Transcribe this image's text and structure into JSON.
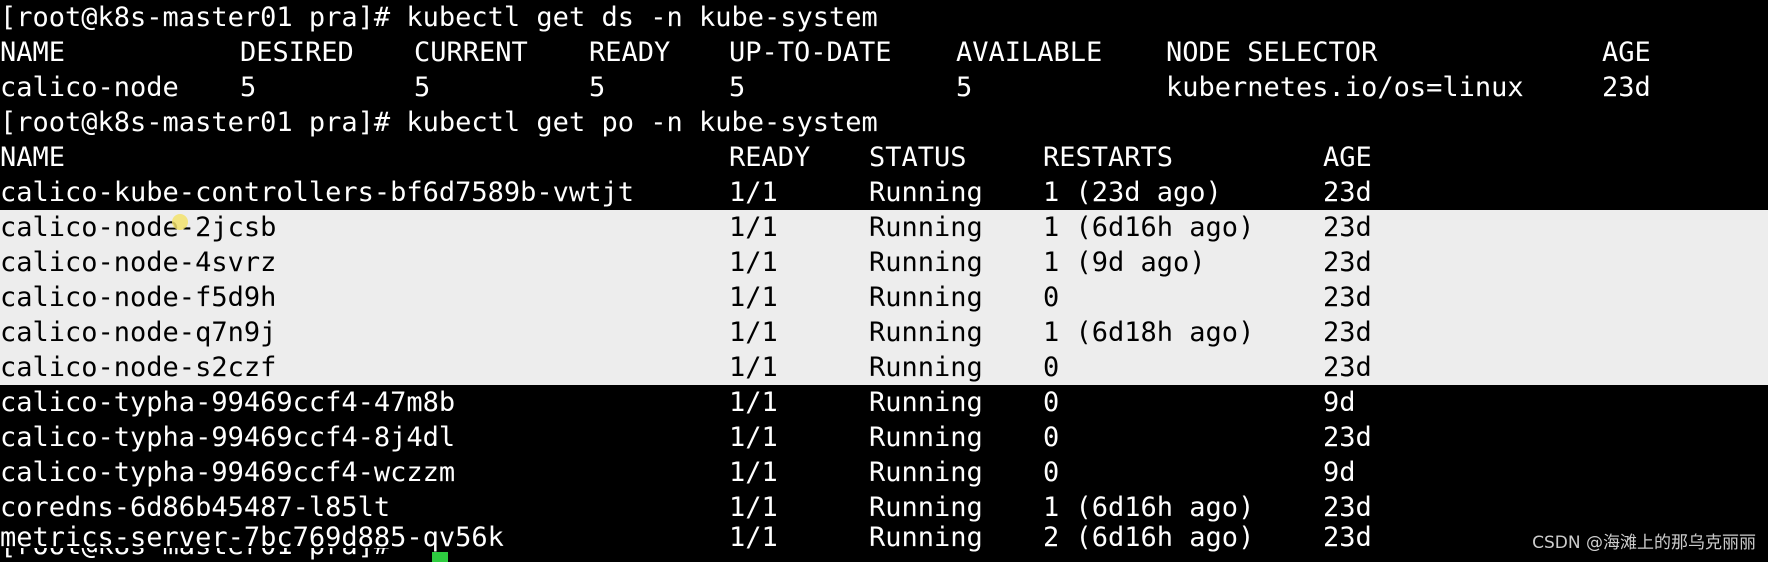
{
  "commands": {
    "ds": "[root@k8s-master01 pra]# kubectl get ds -n kube-system",
    "po": "[root@k8s-master01 pra]# kubectl get po -n kube-system",
    "next_prompt_partial": "[root@k8s-master01 pra]#"
  },
  "ds_table": {
    "headers": [
      "NAME",
      "DESIRED",
      "CURRENT",
      "READY",
      "UP-TO-DATE",
      "AVAILABLE",
      "NODE SELECTOR",
      "AGE"
    ],
    "rows": [
      [
        "calico-node",
        "5",
        "5",
        "5",
        "5",
        "5",
        "kubernetes.io/os=linux",
        "23d"
      ]
    ]
  },
  "po_table": {
    "headers": [
      "NAME",
      "READY",
      "STATUS",
      "RESTARTS",
      "AGE"
    ],
    "rows": [
      [
        "calico-kube-controllers-bf6d7589b-vwtjt",
        "1/1",
        "Running",
        "1 (23d ago)",
        "23d"
      ],
      [
        "calico-node-2jcsb",
        "1/1",
        "Running",
        "1 (6d16h ago)",
        "23d"
      ],
      [
        "calico-node-4svrz",
        "1/1",
        "Running",
        "1 (9d ago)",
        "23d"
      ],
      [
        "calico-node-f5d9h",
        "1/1",
        "Running",
        "0",
        "23d"
      ],
      [
        "calico-node-q7n9j",
        "1/1",
        "Running",
        "1 (6d18h ago)",
        "23d"
      ],
      [
        "calico-node-s2czf",
        "1/1",
        "Running",
        "0",
        "23d"
      ],
      [
        "calico-typha-99469ccf4-47m8b",
        "1/1",
        "Running",
        "0",
        "9d"
      ],
      [
        "calico-typha-99469ccf4-8j4dl",
        "1/1",
        "Running",
        "0",
        "23d"
      ],
      [
        "calico-typha-99469ccf4-wczzm",
        "1/1",
        "Running",
        "0",
        "9d"
      ],
      [
        "coredns-6d86b45487-l85lt",
        "1/1",
        "Running",
        "1 (6d16h ago)",
        "23d"
      ],
      [
        "metrics-server-7bc769d885-qv56k",
        "1/1",
        "Running",
        "2 (6d16h ago)",
        "23d"
      ]
    ]
  },
  "watermark": "CSDN @海滩上的那乌克丽丽",
  "colors": {
    "background": "#000000",
    "foreground": "#ffffff",
    "selection": "#ededed",
    "cursor": "#2ecc40"
  }
}
